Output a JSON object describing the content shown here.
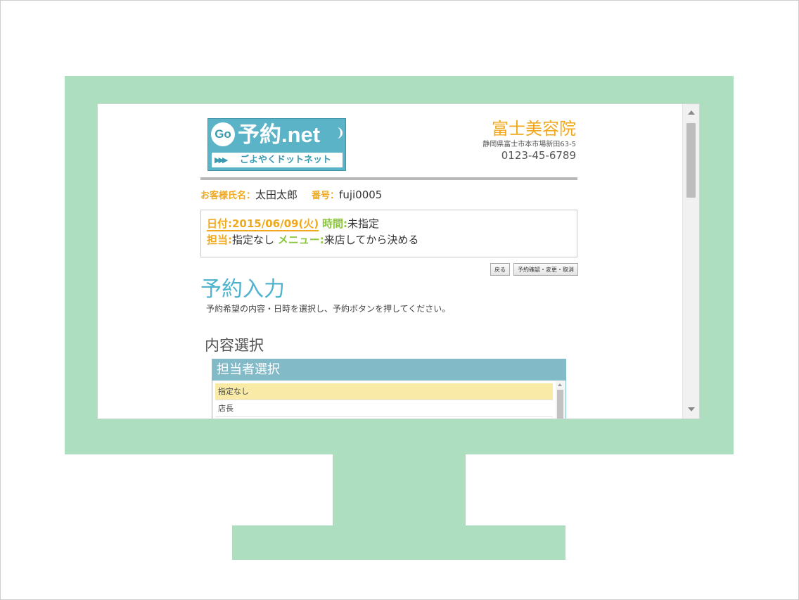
{
  "logo": {
    "go": "Go",
    "title": "予約.net",
    "subtitle": "ごよやくドットネット"
  },
  "shop": {
    "name": "富士美容院",
    "address": "静岡県富士市本市場新田63-5",
    "phone": "0123-45-6789"
  },
  "customer": {
    "name_label": "お客様氏名：",
    "name": "太田太郎",
    "number_label": "番号：",
    "number": "fuji0005"
  },
  "reservation": {
    "date_label": "日付:",
    "date": "2015/06/09(火)",
    "time_label": "時間:",
    "time": "未指定",
    "staff_label": "担当:",
    "staff": "指定なし",
    "menu_label": "メニュー:",
    "menu": "来店してから決める"
  },
  "buttons": {
    "back": "戻る",
    "confirm": "予約確認・変更・取消"
  },
  "page": {
    "title": "予約入力",
    "description": "予約希望の内容・日時を選択し、予約ボタンを押してください。"
  },
  "section": {
    "title": "内容選択"
  },
  "staff_panel": {
    "header": "担当者選択",
    "items": [
      "指定なし",
      "店長"
    ],
    "selected": "指定なし"
  },
  "colors": {
    "monitor": "#aedec0",
    "accent_orange": "#f0a91d",
    "accent_green": "#8cc63f",
    "title_blue": "#4fb3cf",
    "panel_header": "#82bac8",
    "selected_item": "#f9eaa8"
  }
}
